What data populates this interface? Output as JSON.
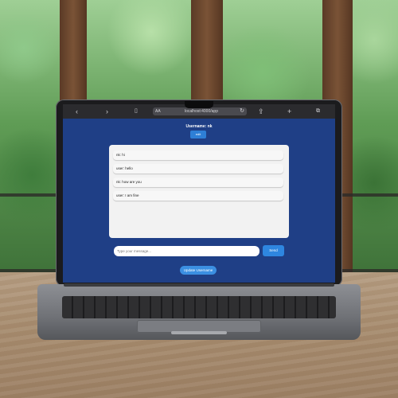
{
  "browser": {
    "address_prefix": "AA",
    "url": "localhost:4000/app"
  },
  "app": {
    "username_label": "Username: nk",
    "edit_label": "edit",
    "messages": [
      {
        "text": "nk: hi"
      },
      {
        "text": "user: hello"
      },
      {
        "text": "nk: how are you"
      },
      {
        "text": "user: I am fine"
      }
    ],
    "input_placeholder": "Type your message...",
    "send_label": "Send",
    "update_label": "Update Username"
  },
  "colors": {
    "app_background": "#1f3f86",
    "primary_button": "#2e86e0",
    "chat_box": "#f2f2f2"
  }
}
